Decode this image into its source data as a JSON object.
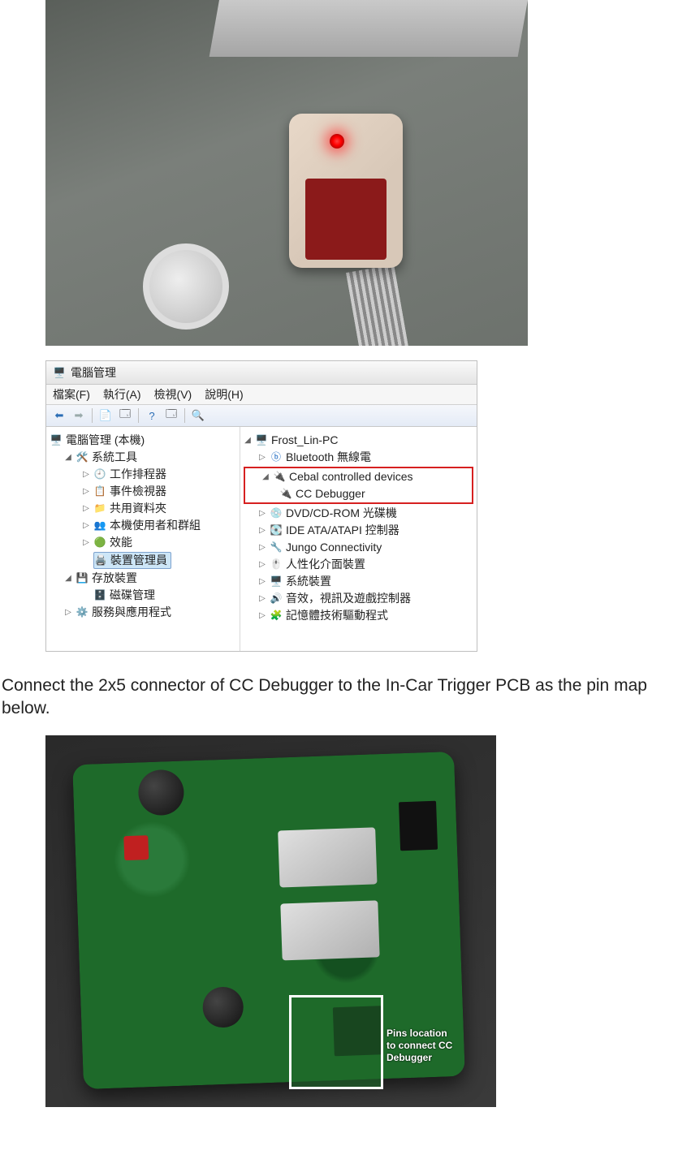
{
  "mgmt": {
    "title": "電腦管理",
    "menu": {
      "file": "檔案(F)",
      "action": "執行(A)",
      "view": "檢視(V)",
      "help": "說明(H)"
    },
    "left": {
      "root": "電腦管理 (本機)",
      "sys_tools": "系統工具",
      "task_scheduler": "工作排程器",
      "event_viewer": "事件檢視器",
      "shared_folders": "共用資料夾",
      "local_users": "本機使用者和群組",
      "performance": "效能",
      "device_manager": "裝置管理員",
      "storage": "存放裝置",
      "disk_mgmt": "磁碟管理",
      "services_apps": "服務與應用程式"
    },
    "right": {
      "root": "Frost_Lin-PC",
      "bluetooth": "Bluetooth 無線電",
      "cebal": "Cebal controlled devices",
      "cc_debugger": "CC Debugger",
      "dvd": "DVD/CD-ROM 光碟機",
      "ide": "IDE ATA/ATAPI 控制器",
      "jungo": "Jungo Connectivity",
      "hid": "人性化介面裝置",
      "system_dev": "系統裝置",
      "sound": "音效，視訊及遊戲控制器",
      "memory": "記憶體技術驅動程式"
    }
  },
  "caption": "Connect the 2x5 connector of CC Debugger to the In-Car Trigger PCB as the pin map below.",
  "pcb": {
    "pin_label_l1": "Pins location",
    "pin_label_l2": "to connect CC Debugger"
  }
}
